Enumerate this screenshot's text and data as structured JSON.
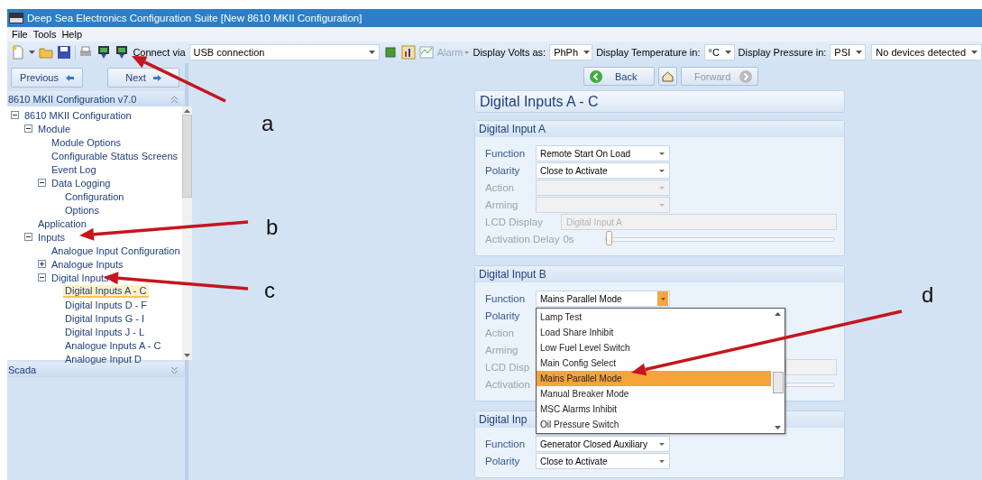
{
  "window": {
    "title": "Deep Sea Electronics Configuration Suite [New 8610 MKII Configuration]"
  },
  "menu": [
    "File",
    "Tools",
    "Help"
  ],
  "toolbar": {
    "connect_label": "Connect via",
    "connection": "USB connection",
    "alarm": {
      "label": "Alarm",
      "disabled": true
    },
    "volts_label": "Display Volts as:",
    "volts": "PhPh",
    "temperature_label": "Display Temperature in:",
    "temperature": "°C",
    "pressure_label": "Display Pressure in:",
    "pressure": "PSI",
    "device": "No devices detected"
  },
  "navigation": {
    "previous": "Previous",
    "next": "Next"
  },
  "sidebar": {
    "title": "8610 MKII Configuration v7.0",
    "items": [
      {
        "label": "8610 MKII Configuration",
        "expanded": true,
        "selected": false,
        "children": [
          {
            "label": "Module",
            "expanded": true,
            "selected": false,
            "children": [
              {
                "label": "Module Options",
                "selected": false
              },
              {
                "label": "Configurable Status Screens",
                "selected": false
              },
              {
                "label": "Event Log",
                "selected": false
              },
              {
                "label": "Data Logging",
                "expanded": true,
                "selected": false,
                "children": [
                  {
                    "label": "Configuration",
                    "selected": false
                  },
                  {
                    "label": "Options",
                    "selected": false
                  }
                ]
              }
            ]
          },
          {
            "label": "Application",
            "selected": false
          },
          {
            "label": "Inputs",
            "expanded": true,
            "selected": false,
            "children": [
              {
                "label": "Analogue Input Configuration",
                "selected": false
              },
              {
                "label": "Analogue Inputs",
                "expanded": false,
                "selected": false
              },
              {
                "label": "Digital Inputs",
                "expanded": true,
                "selected": false,
                "children": [
                  {
                    "label": "Digital Inputs A - C",
                    "selected": true
                  },
                  {
                    "label": "Digital Inputs D - F",
                    "selected": false
                  },
                  {
                    "label": "Digital Inputs G - I",
                    "selected": false
                  },
                  {
                    "label": "Digital Inputs J - L",
                    "selected": false
                  },
                  {
                    "label": "Analogue Inputs A - C",
                    "selected": false
                  },
                  {
                    "label": "Analogue Input D",
                    "selected": false
                  }
                ]
              }
            ]
          }
        ]
      }
    ],
    "scada": "Scada"
  },
  "history": {
    "back": {
      "label": "Back",
      "disabled": false
    },
    "forward": {
      "label": "Forward",
      "disabled": true
    }
  },
  "page_title": "Digital Inputs A - C",
  "groups": [
    {
      "title": "Digital Input A",
      "rows": [
        {
          "kind": "combo",
          "label": "Function",
          "value": "Remote Start On Load",
          "disabled": false
        },
        {
          "kind": "combo",
          "label": "Polarity",
          "value": "Close to Activate",
          "disabled": false
        },
        {
          "kind": "combo",
          "label": "Action",
          "disabled": true
        },
        {
          "kind": "combo",
          "label": "Arming",
          "disabled": true
        },
        {
          "kind": "text",
          "label": "LCD Display",
          "value": "Digital Input A",
          "disabled": true
        },
        {
          "kind": "slider",
          "label": "Activation Delay",
          "reading": "0s",
          "level": 0,
          "disabled": true
        }
      ]
    },
    {
      "title": "Digital Input B",
      "rows": [
        {
          "kind": "combo",
          "label": "Function",
          "value": "Mains Parallel Mode",
          "disabled": false,
          "open": true,
          "options": [
            {
              "label": "Lamp Test",
              "selected": false
            },
            {
              "label": "Load Share Inhibit",
              "selected": false
            },
            {
              "label": "Low Fuel Level Switch",
              "selected": false
            },
            {
              "label": "Main Config Select",
              "selected": false
            },
            {
              "label": "Mains Parallel Mode",
              "selected": true
            },
            {
              "label": "Manual Breaker Mode",
              "selected": false
            },
            {
              "label": "MSC Alarms Inhibit",
              "selected": false
            },
            {
              "label": "Oil Pressure Switch",
              "selected": false
            }
          ]
        },
        {
          "kind": "label",
          "label": "Polarity",
          "disabled": false
        },
        {
          "kind": "label",
          "label": "Action",
          "disabled": true
        },
        {
          "kind": "label",
          "label": "Arming",
          "disabled": true
        },
        {
          "kind": "text-part",
          "label": "LCD Disp",
          "disabled": true
        },
        {
          "kind": "slider-part",
          "label": "Activation",
          "disabled": true
        }
      ]
    },
    {
      "title": "Digital Inp",
      "rows": [
        {
          "kind": "combo",
          "label": "Function",
          "value": "Generator Closed Auxiliary",
          "disabled": false
        },
        {
          "kind": "combo",
          "label": "Polarity",
          "value": "Close to Activate",
          "disabled": false
        }
      ]
    }
  ],
  "annotations": [
    "a",
    "b",
    "c",
    "d"
  ]
}
